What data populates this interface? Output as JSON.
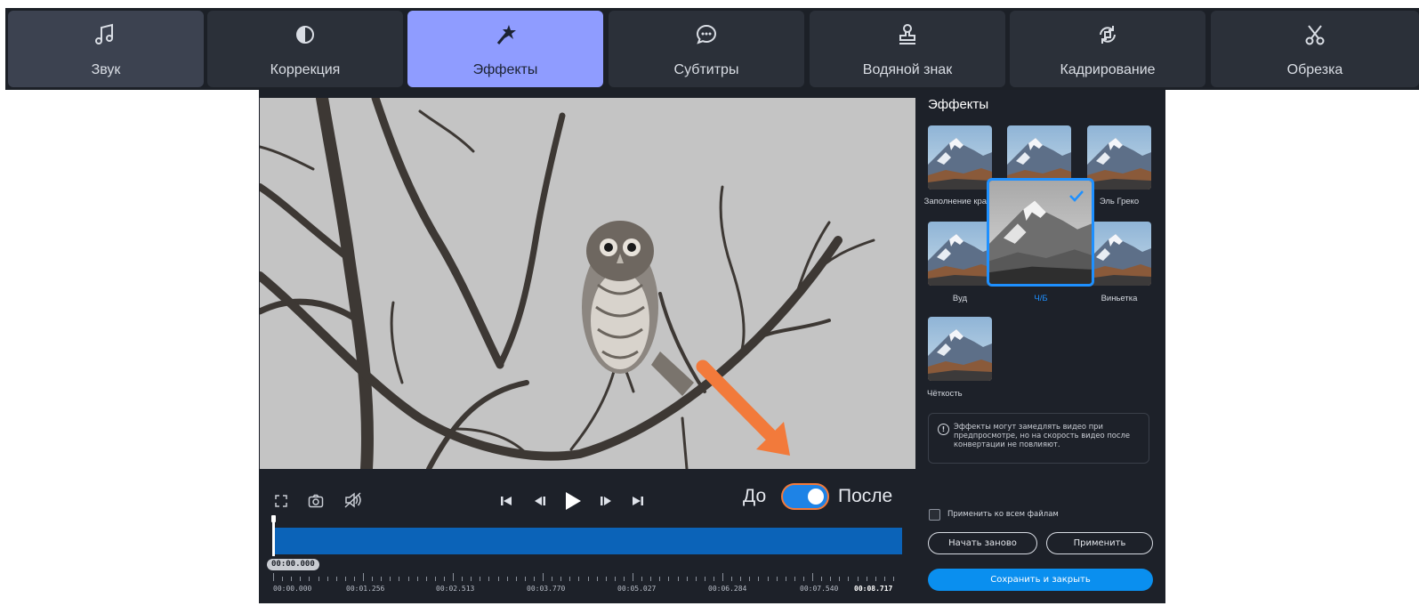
{
  "tabs": [
    {
      "label": "Звук",
      "icon": "music-note-icon"
    },
    {
      "label": "Коррекция",
      "icon": "contrast-icon"
    },
    {
      "label": "Эффекты",
      "icon": "magic-wand-icon"
    },
    {
      "label": "Субтитры",
      "icon": "speech-bubble-icon"
    },
    {
      "label": "Водяной знак",
      "icon": "stamp-icon"
    },
    {
      "label": "Кадрирование",
      "icon": "crop-rotate-icon"
    },
    {
      "label": "Обрезка",
      "icon": "scissors-icon"
    }
  ],
  "active_tab": "Эффекты",
  "player": {
    "before_label": "До",
    "after_label": "После",
    "toggle_state": "after",
    "current_time": "00:00.000",
    "ticks": [
      "00:00.000",
      "00:01.256",
      "00:02.513",
      "00:03.770",
      "00:05.027",
      "00:06.284",
      "00:07.540"
    ],
    "end_time": "00:08.717"
  },
  "effects_panel": {
    "title": "Эффекты",
    "items": [
      {
        "label": "Заполнение краёв"
      },
      {
        "label": ""
      },
      {
        "label": "Эль Греко"
      },
      {
        "label": "Вуд"
      },
      {
        "label": "Ч/Б",
        "selected": true
      },
      {
        "label": "Виньетка"
      },
      {
        "label": "Чёткость"
      }
    ],
    "note": "Эффекты могут замедлять видео при предпросмотре, но на скорость видео после конвертации не повлияют.",
    "apply_all_label": "Применить ко всем файлам",
    "apply_all_checked": false,
    "reset_button": "Начать заново",
    "apply_button": "Применить",
    "save_button": "Сохранить и закрыть"
  },
  "colors": {
    "active_tab": "#8f9cff",
    "accent_blue": "#0a8fef",
    "annotation_arrow": "#f27a3b",
    "window_bg": "#1d2129"
  }
}
